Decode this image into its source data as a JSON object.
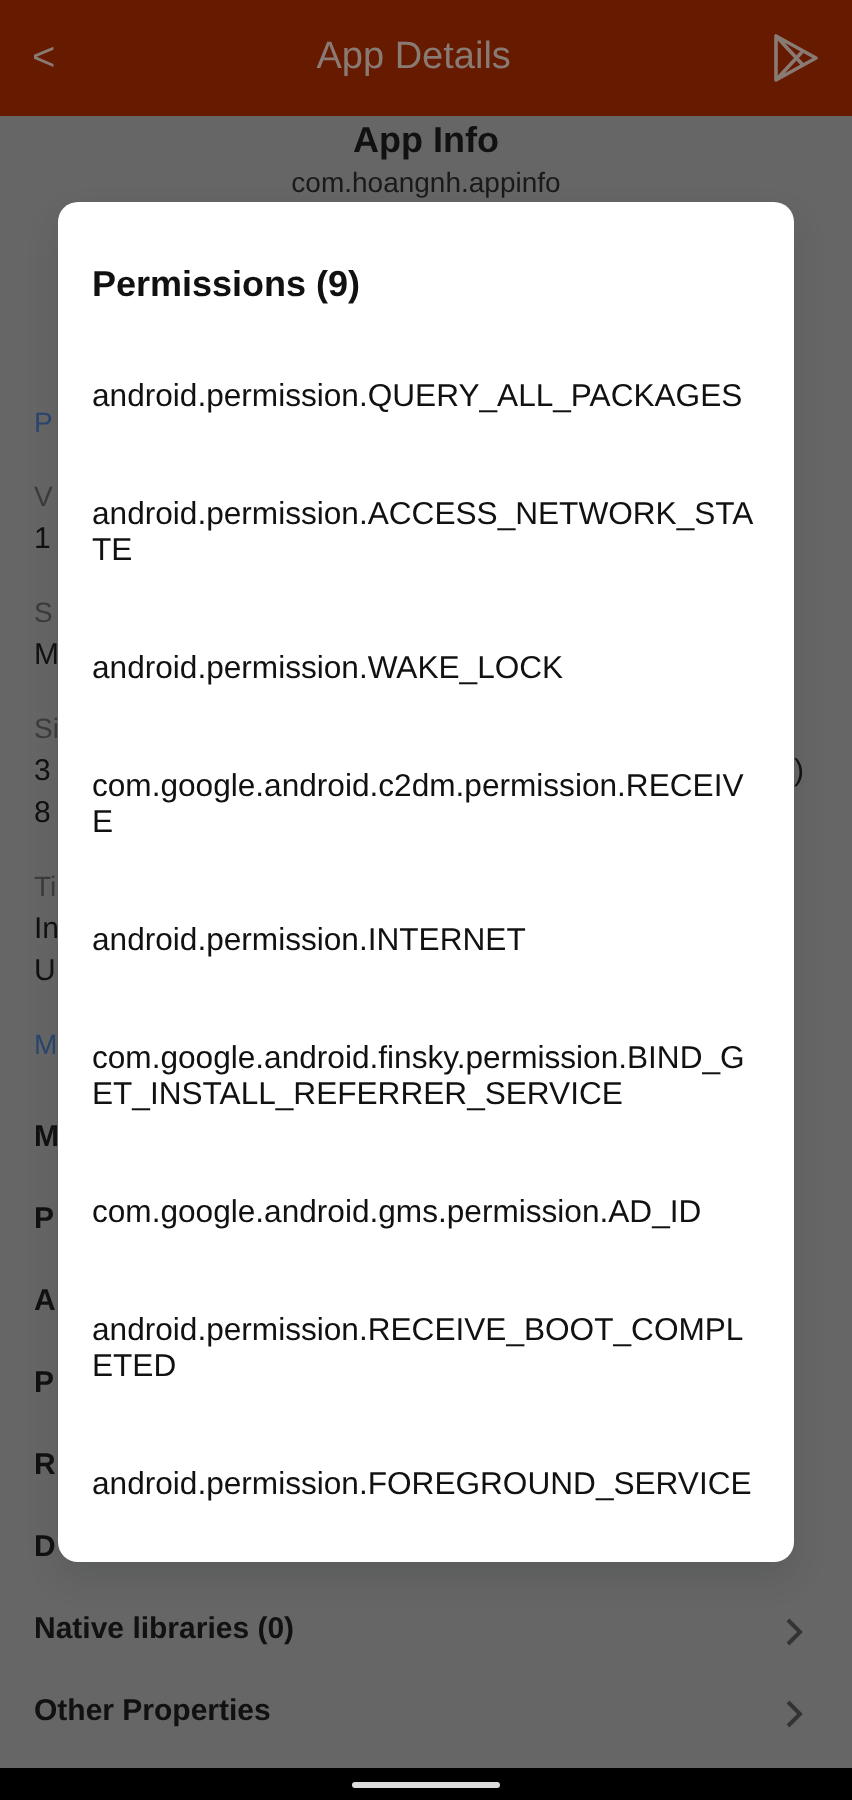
{
  "app_bar": {
    "back": "<",
    "title": "App Details"
  },
  "header": {
    "title": "App Info",
    "package": "com.hoangnh.appinfo"
  },
  "background_sections": [
    {
      "kind": "header",
      "lines": [
        "P"
      ]
    },
    {
      "kind": "field",
      "lines": [
        "V",
        "1"
      ]
    },
    {
      "kind": "field",
      "lines": [
        "S",
        "M"
      ]
    },
    {
      "kind": "field",
      "lines": [
        "Si",
        "3",
        "8"
      ],
      "right": ")"
    },
    {
      "kind": "field",
      "lines": [
        "Ti",
        "In",
        "U"
      ]
    },
    {
      "kind": "header",
      "lines": [
        "M"
      ]
    }
  ],
  "menu_items": [
    {
      "label": "M",
      "chevron": false
    },
    {
      "label": "P",
      "chevron": false
    },
    {
      "label": "A",
      "chevron": false
    },
    {
      "label": "P",
      "chevron": false
    },
    {
      "label": "R",
      "chevron": false
    },
    {
      "label": "D",
      "chevron": false
    },
    {
      "label": "Native libraries (0)",
      "chevron": true
    },
    {
      "label": "Other Properties",
      "chevron": true
    }
  ],
  "dialog": {
    "title": "Permissions (9)",
    "items": [
      "android.permission.QUERY_ALL_PACKAGES",
      "android.permission.ACCESS_NETWORK_STATE",
      "android.permission.WAKE_LOCK",
      "com.google.android.c2dm.permission.RECEIVE",
      "android.permission.INTERNET",
      "com.google.android.finsky.permission.BIND_GET_INSTALL_REFERRER_SERVICE",
      "com.google.android.gms.permission.AD_ID",
      "android.permission.RECEIVE_BOOT_COMPLETED",
      "android.permission.FOREGROUND_SERVICE"
    ]
  }
}
